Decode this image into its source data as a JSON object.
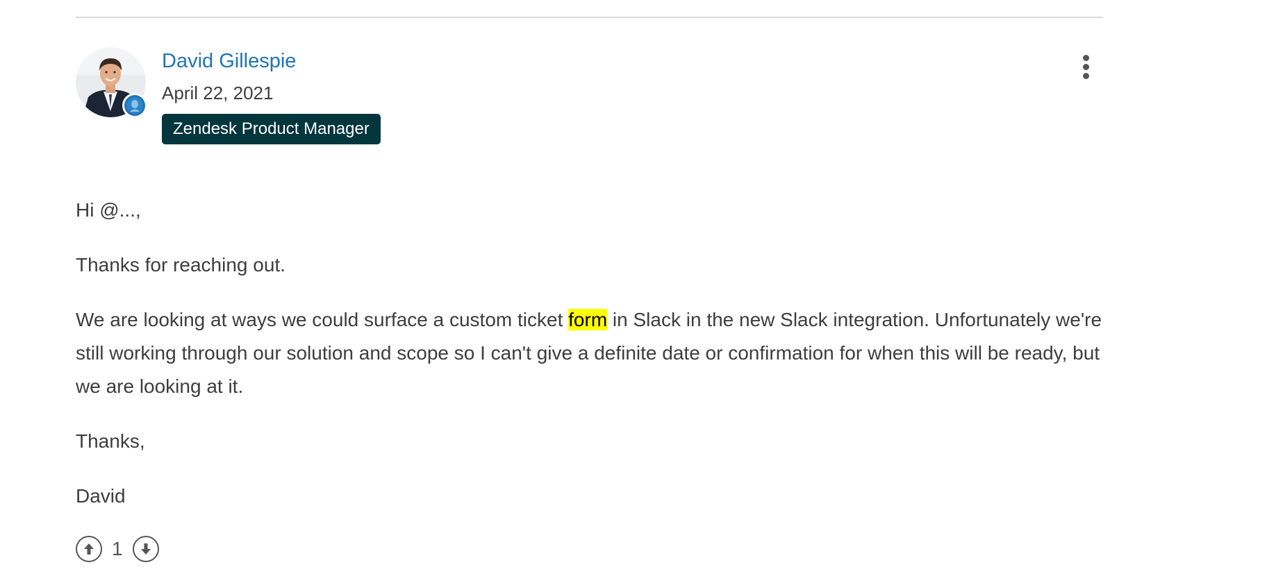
{
  "comment": {
    "author": {
      "name": "David Gillespie",
      "date": "April 22, 2021",
      "role_badge": "Zendesk Product Manager"
    },
    "menu_icon": "more-vertical-icon",
    "paragraphs": {
      "p1": "Hi @...,",
      "p2": "Thanks for reaching out.",
      "p3_before": "We are looking at ways we could surface a custom ticket ",
      "p3_highlight": "form",
      "p3_after": " in Slack in the new Slack integration. Unfortunately we're still working through our solution and scope so I can't give a definite date or confirmation for when this will be ready, but we are looking at it.",
      "p4": "Thanks,",
      "p5": "David"
    },
    "votes": {
      "count": "1",
      "upvote_icon": "upvote-arrow-icon",
      "downvote_icon": "downvote-arrow-icon"
    },
    "colors": {
      "link": "#1f73b7",
      "badge_bg": "#03363d",
      "highlight": "#ffff00",
      "text": "#3d3d3d"
    }
  }
}
